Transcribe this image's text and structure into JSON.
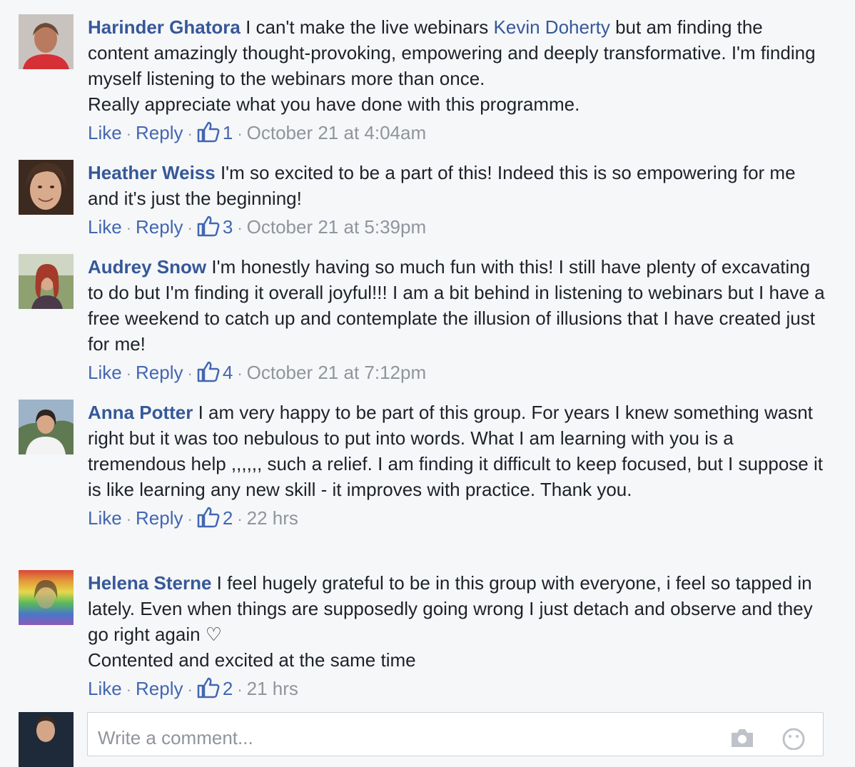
{
  "comments": [
    {
      "author": "Harinder Ghatora",
      "text_before": "I can't make the live webinars",
      "mention": "Kevin Doherty",
      "text_after": "but am finding the content amazingly thought-provoking, empowering and deeply transformative. I'm finding myself listening to the webinars more than once.",
      "text_line2": "Really appreciate what you have done with this programme.",
      "like_label": "Like",
      "reply_label": "Reply",
      "like_count": "1",
      "timestamp": "October 21 at 4:04am"
    },
    {
      "author": "Heather Weiss",
      "text": "I'm so excited to be a part of this! Indeed this is so empowering for me and it's just the beginning!",
      "like_label": "Like",
      "reply_label": "Reply",
      "like_count": "3",
      "timestamp": "October 21 at 5:39pm"
    },
    {
      "author": "Audrey Snow",
      "text": "I'm honestly having so much fun with this! I still have plenty of excavating to do but I'm finding it overall joyful!!! I am a bit behind in listening to webinars but I have a free weekend to catch up and contemplate the illusion of illusions that I have created just for me!",
      "like_label": "Like",
      "reply_label": "Reply",
      "like_count": "4",
      "timestamp": "October 21 at 7:12pm"
    },
    {
      "author": "Anna Potter",
      "text": "I am very happy to be part of this group. For years I knew something wasnt right but it was too nebulous to put into words. What I am learning with you is a tremendous help ,,,,,, such a relief. I am finding it difficult to keep focused, but I suppose it is like learning any new skill - it improves with practice. Thank you.",
      "like_label": "Like",
      "reply_label": "Reply",
      "like_count": "2",
      "timestamp": "22 hrs"
    },
    {
      "author": "Helena Sterne",
      "text": "I feel hugely grateful to be in this group with everyone, i feel so tapped in lately. Even when things are supposedly going wrong I just detach and observe and they go right again ♡",
      "text_line2": "Contented and excited at the same time",
      "like_label": "Like",
      "reply_label": "Reply",
      "like_count": "2",
      "timestamp": "21 hrs"
    }
  ],
  "composer": {
    "placeholder": "Write a comment..."
  },
  "icons": {
    "like": "thumbs-up-icon",
    "camera": "camera-icon",
    "emoji": "emoji-icon"
  },
  "colors": {
    "link": "#365899",
    "action_link": "#4267b2",
    "meta": "#90949c",
    "background": "#f6f7f9"
  }
}
